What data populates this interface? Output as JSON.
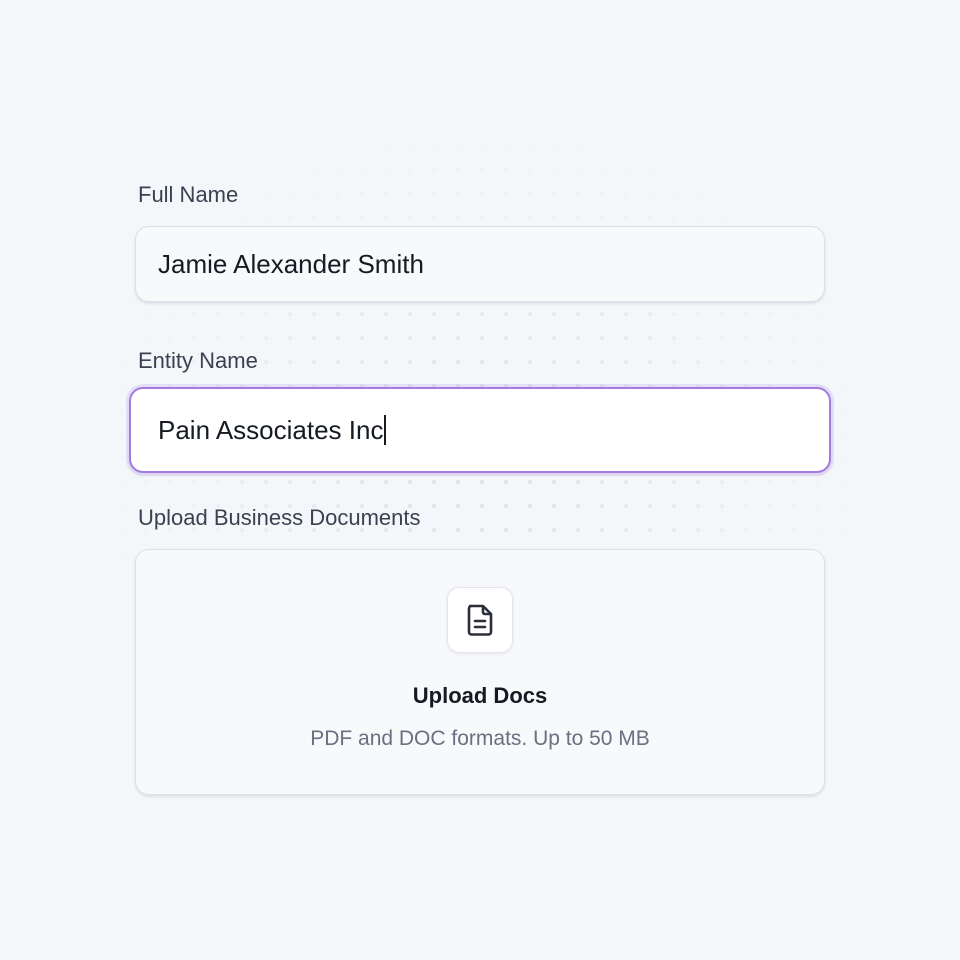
{
  "fields": {
    "full_name": {
      "label": "Full Name",
      "value": "Jamie Alexander Smith"
    },
    "entity_name": {
      "label": "Entity Name",
      "value": "Pain Associates Inc",
      "focused": true
    }
  },
  "upload": {
    "label": "Upload Business Documents",
    "icon": "document-icon",
    "title": "Upload Docs",
    "hint": "PDF and DOC formats. Up to 50 MB"
  },
  "colors": {
    "background": "#f4f7fa",
    "focus_border": "#a37be0",
    "text_primary": "#161a22",
    "text_secondary": "#6a7080"
  }
}
